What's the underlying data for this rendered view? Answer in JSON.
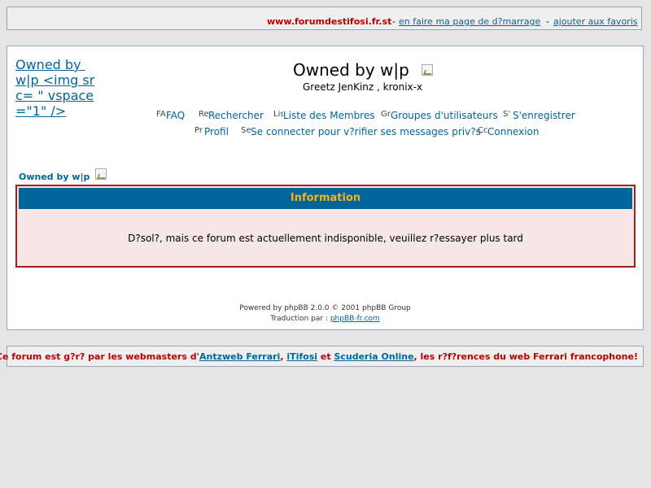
{
  "topbar": {
    "site": "www.forumdestifosi.fr.st",
    "sep1": "-",
    "link1": "en faire ma page de d?marrage",
    "sep2": "-",
    "link2": "ajouter aux favoris"
  },
  "header": {
    "logo_alt": "Owned by w|p <img src= \" vspace=\"1\" />",
    "title": "Owned by w|p",
    "greetz": "Greetz JenKinz , kronix-x"
  },
  "nav": {
    "row1": [
      {
        "icon": "FA",
        "label": "FAQ"
      },
      {
        "icon": "Re",
        "label": "Rechercher"
      },
      {
        "icon": "Lis",
        "label": "Liste des Membres"
      },
      {
        "icon": "Gr",
        "label": "Groupes d'utilisateurs"
      },
      {
        "icon": "S'",
        "label": "S'enregistrer"
      }
    ],
    "row2": [
      {
        "icon": "Pr",
        "label": "Profil"
      },
      {
        "icon": "Se",
        "label": "Se connecter pour v?rifier ses messages priv?s"
      },
      {
        "icon": "Cc",
        "label": "Connexion"
      }
    ]
  },
  "breadcrumb": "Owned by w|p",
  "info": {
    "heading": "Information",
    "message": "D?sol?, mais ce forum est actuellement indisponible, veuillez r?essayer plus tard"
  },
  "powered": {
    "line1": "Powered by phpBB 2.0.0 © 2001 phpBB Group",
    "line2_prefix": "Traduction par :",
    "line2_link": "phpBB-fr.com"
  },
  "footer": {
    "text1": "Ce forum est g?r? par les webmasters d'",
    "link1": "Antzweb Ferrari",
    "sep1": ",",
    "link2": "iTifosi",
    "sep2": " et ",
    "link3": "Scuderia Online",
    "text2": ", les r?f?rences du web Ferrari francophone!"
  }
}
